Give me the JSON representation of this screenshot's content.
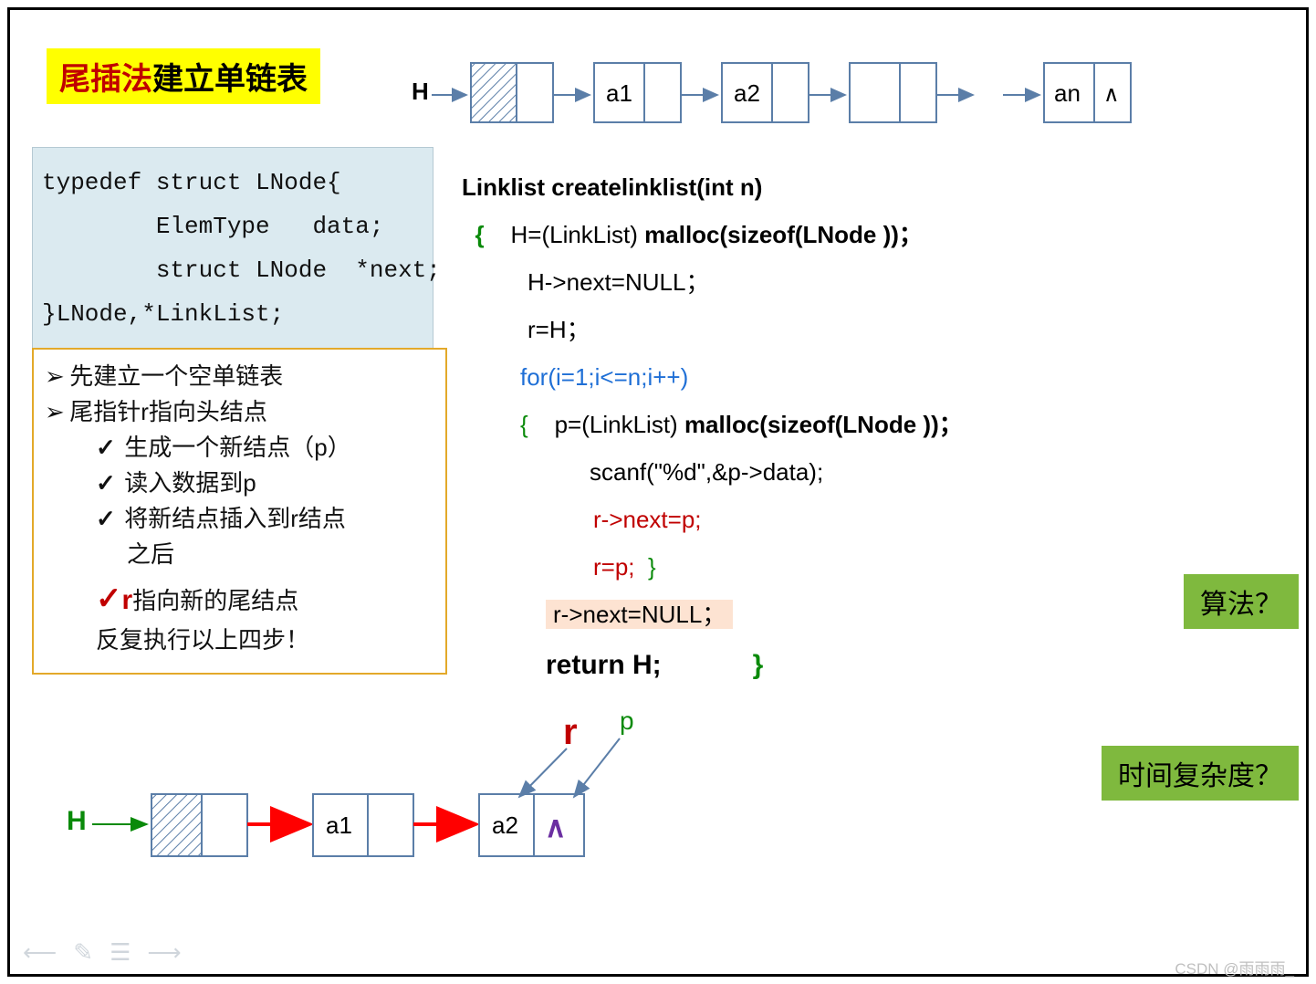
{
  "title": {
    "red": "尾插法",
    "black": "建立单链表"
  },
  "typedef": {
    "l1": "typedef struct LNode{",
    "l2": "        ElemType   data;",
    "l3": "        struct LNode  *next;",
    "l4": "}LNode,*LinkList;"
  },
  "steps": {
    "s1": "先建立一个空单链表",
    "s2": "尾指针r指向头结点",
    "c1": "生成一个新结点（p）",
    "c2": "读入数据到p",
    "c3": "将新结点插入到r结点",
    "c3b": "之后",
    "r1_pre": "r",
    "r1": "指向新的尾结点",
    "r2": "反复执行以上四步！"
  },
  "code": {
    "sig": "Linklist  createlinklist(int n)",
    "brace_open": "{",
    "l1a": "H=(LinkList)   ",
    "l1b": "malloc(sizeof(LNode ))；",
    "l2": "H->next=NULL；",
    "l3": "r=H；",
    "for": "for(i=1;i<=n;i++)",
    "for_open": "{",
    "p1a": "p=(LinkList)   ",
    "p1b": "malloc(sizeof(LNode ))；",
    "scan": "scanf(\"%d\",&p->data);",
    "rn": "r->next=p;",
    "rp": "r=p;",
    "for_close": "}",
    "null": "r->next=NULL；",
    "ret": "return H;",
    "brace_close": "}"
  },
  "labels": {
    "H_top": "H",
    "a1": "a1",
    "a2": "a2",
    "an": "an",
    "caret": "∧",
    "H_bot": "H",
    "r": "r",
    "p": "p"
  },
  "boxes": {
    "algo": "算法？",
    "time": "时间复杂度？"
  },
  "watermark": "CSDN @雨雨雨_"
}
